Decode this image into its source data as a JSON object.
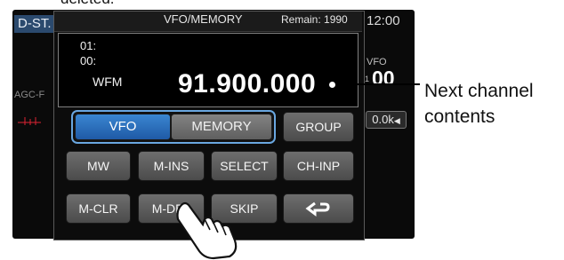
{
  "caption_fragment": "deleted.",
  "background_screen": {
    "mode_tag": "D-ST.",
    "clock": "12:00",
    "vfo_label": "VFO",
    "side_small": "1",
    "big_digits": "00",
    "agc_label": "AGC-F",
    "filter_btn": "0.0k"
  },
  "dialog": {
    "title": "VFO/MEMORY",
    "remain": "Remain: 1990",
    "display": {
      "line1": "01:",
      "line2": "00:",
      "mode": "WFM",
      "frequency": "91.900.000"
    }
  },
  "buttons": {
    "vfo": "VFO",
    "memory": "MEMORY",
    "group": "GROUP",
    "mw": "MW",
    "m_ins": "M-INS",
    "select": "SELECT",
    "ch_inp": "CH-INP",
    "m_clr": "M-CLR",
    "m_del": "M-DEL",
    "skip": "SKIP",
    "back_icon": "return-arrow-icon"
  },
  "callout": {
    "line1": "Next channel",
    "line2": "contents"
  },
  "colors": {
    "active_button": "#2f74c0",
    "button_gray": "#5e5e5e"
  }
}
